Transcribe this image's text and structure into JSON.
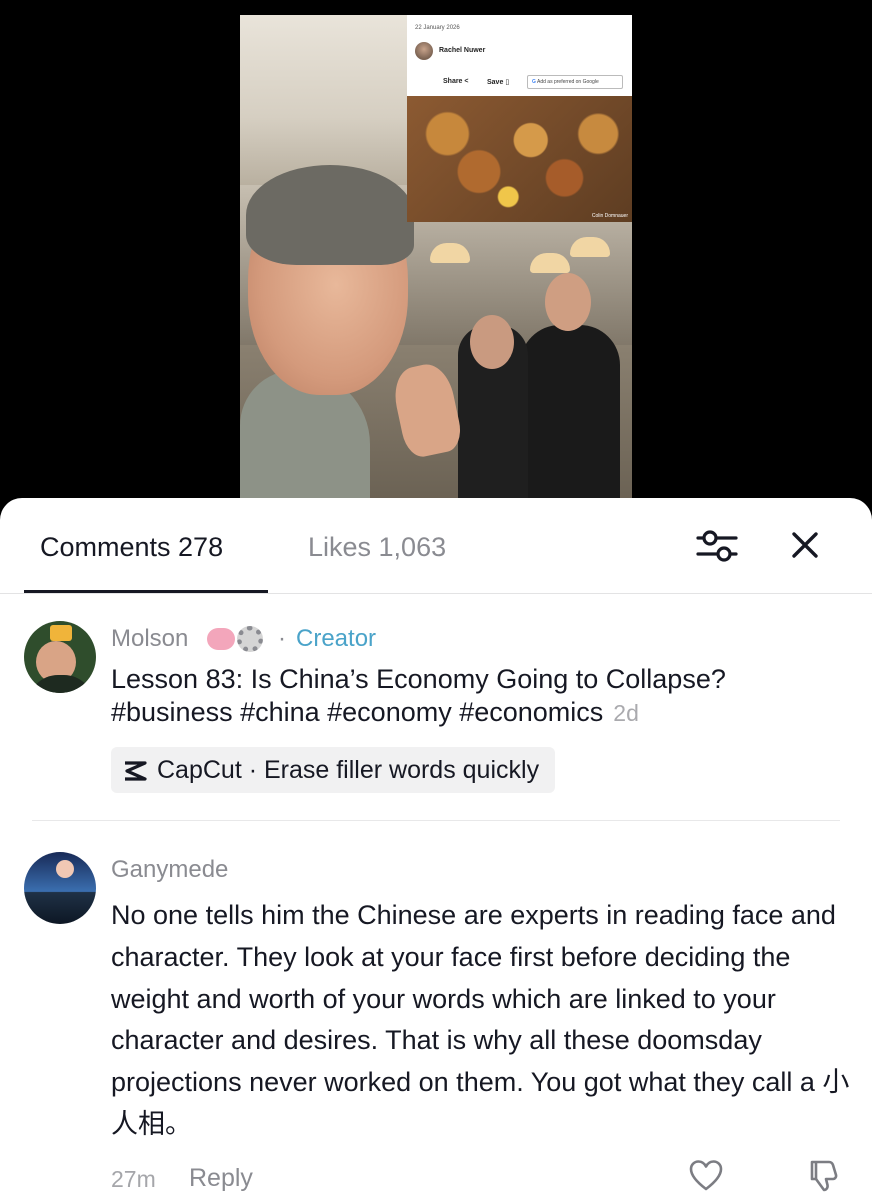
{
  "video": {
    "article": {
      "date": "22 January 2026",
      "author": "Rachel Nuwer",
      "share_label": "Share",
      "save_label": "Save",
      "google_label": "Add as preferred on Google"
    },
    "photo_credit": "Colin Domnauer"
  },
  "sheet": {
    "tabs": [
      {
        "label": "Comments 278",
        "active": true
      },
      {
        "label": "Likes 1,063",
        "active": false
      }
    ],
    "icons": {
      "filter": "sliders-icon",
      "close": "close-icon"
    }
  },
  "comments": [
    {
      "author": "Molson",
      "emoji": [
        "brain-icon",
        "gear-icon"
      ],
      "separator": "·",
      "role": "Creator",
      "text": "Lesson 83: Is China’s Economy Going to Collapse? #business #china #economy #economics",
      "time": "2d",
      "chip": {
        "icon": "capcut-icon",
        "label": "CapCut · Erase filler words quickly"
      }
    },
    {
      "author": "Ganymede",
      "text": "No one tells him the Chinese are experts in reading face and character. They look at your face first before deciding the weight and worth of your words which are linked to your character and desires. That is why all these doomsday projections never worked on them. You got what they call a 小人相。",
      "time": "27m",
      "reply_label": "Reply"
    }
  ],
  "colors": {
    "accent_creator": "#4aa3c9",
    "text_primary": "#161823",
    "text_secondary": "#8a8b91"
  }
}
